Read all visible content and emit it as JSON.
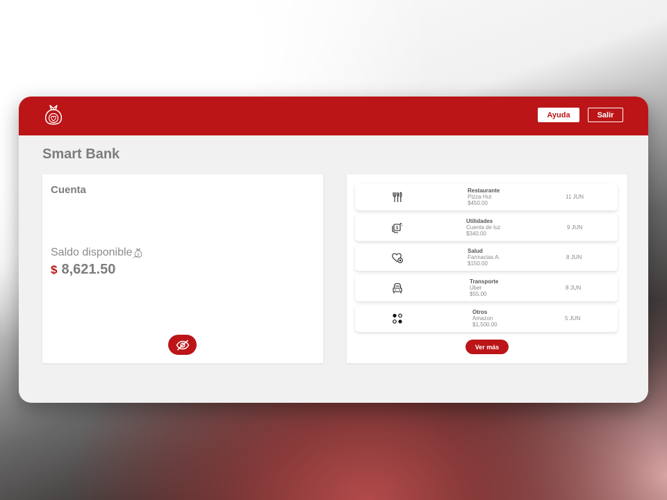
{
  "header": {
    "logo_icon": "heart-money-bag-icon",
    "help_label": "Ayuda",
    "exit_label": "Salir",
    "accent_color": "#bb1517"
  },
  "page": {
    "title": "Smart Bank"
  },
  "account": {
    "title": "Cuenta",
    "balance_label": "Saldo disponible",
    "balance_icon": "money-bag-icon",
    "currency_symbol": "$",
    "balance_value": "8,621.50",
    "hide_icon": "eye-off-icon"
  },
  "transactions": {
    "items": [
      {
        "category": "Restaurante",
        "merchant": "Pizza Hut",
        "amount": "$450.00",
        "date": "11 JUN",
        "icon": "utensils-icon"
      },
      {
        "category": "Utilidades",
        "merchant": "Cuenta de luz",
        "amount": "$340.00",
        "date": "9 JUN",
        "icon": "bill-hand-icon"
      },
      {
        "category": "Salud",
        "merchant": "Farmacias A.",
        "amount": "$150.00",
        "date": "8 JUN",
        "icon": "heart-health-icon"
      },
      {
        "category": "Transporte",
        "merchant": "Uber",
        "amount": "$55.00",
        "date": "8 JUN",
        "icon": "car-icon"
      },
      {
        "category": "Otros",
        "merchant": "Amazon",
        "amount": "$1,500.00",
        "date": "5 JUN",
        "icon": "dots-grid-icon"
      }
    ],
    "more_label": "Ver más"
  }
}
